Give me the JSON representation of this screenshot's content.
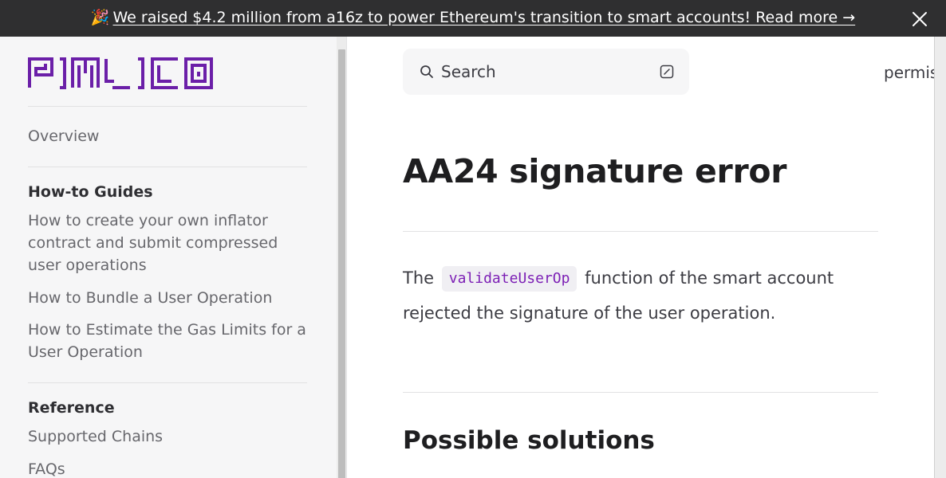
{
  "banner": {
    "emoji": "🎉",
    "text": "We raised $4.2 million from a16z to power Ethereum's transition to smart accounts! Read more →",
    "close_icon": "close-icon"
  },
  "sidebar": {
    "logo_text": "PIMLICO",
    "overview": "Overview",
    "sections": [
      {
        "heading": "How-to Guides",
        "items": [
          "How to create your own inflator contract and submit compressed user operations",
          "How to Bundle a User Operation",
          "How to Estimate the Gas Limits for a User Operation"
        ]
      },
      {
        "heading": "Reference",
        "items": [
          "Supported Chains",
          "FAQs"
        ]
      }
    ]
  },
  "search": {
    "placeholder": "Search",
    "icon": "search-icon",
    "shortcut_icon": "keyboard-shortcut-icon"
  },
  "top_nav": {
    "link_partial": "permis"
  },
  "main": {
    "title": "AA24 signature error",
    "para_before": "The",
    "code": "validateUserOp",
    "para_after": "function of the smart account rejected the signature of the user operation.",
    "h2": "Possible solutions"
  },
  "colors": {
    "brand": "#6b1fa8",
    "code_text": "#7c1fb5",
    "banner_bg": "#2f2f30"
  }
}
